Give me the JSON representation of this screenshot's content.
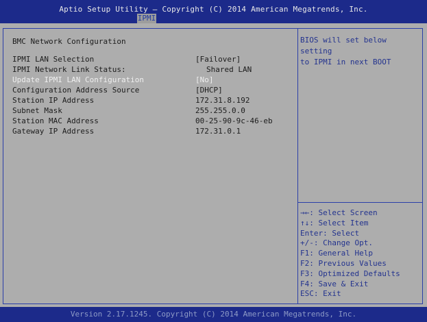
{
  "header": {
    "title": "Aptio Setup Utility – Copyright (C) 2014 American Megatrends, Inc.",
    "active_tab": "IPMI"
  },
  "main": {
    "section_title": "BMC Network Configuration",
    "settings": [
      {
        "label": "IPMI LAN Selection",
        "value": "[Failover]"
      },
      {
        "label": "IPMI Network Link Status:",
        "value": "Shared LAN"
      },
      {
        "label": "Update IPMI LAN Configuration",
        "value": "[No]"
      },
      {
        "label": "Configuration Address Source",
        "value": "[DHCP]"
      },
      {
        "label": "Station IP Address",
        "value": "172.31.8.192"
      },
      {
        "label": "Subnet Mask",
        "value": "255.255.0.0"
      },
      {
        "label": "Station MAC Address",
        "value": "00-25-90-9c-46-eb"
      },
      {
        "label": "Gateway IP Address",
        "value": "172.31.0.1"
      }
    ]
  },
  "help": {
    "text_line1": "BIOS will set below setting",
    "text_line2": "to IPMI in next BOOT"
  },
  "keys": [
    "→←: Select Screen",
    "↑↓: Select Item",
    "Enter: Select",
    "+/-: Change Opt.",
    "F1: General Help",
    "F2: Previous Values",
    "F3: Optimized Defaults",
    "F4: Save & Exit",
    "ESC: Exit"
  ],
  "footer": {
    "text": "Version 2.17.1245. Copyright (C) 2014 American Megatrends, Inc."
  },
  "colors": {
    "header_bg": "#1c2a8a",
    "panel_bg": "#adadad",
    "border": "#2a3ea8",
    "help_text": "#23338e",
    "selected_text": "#efefef"
  }
}
